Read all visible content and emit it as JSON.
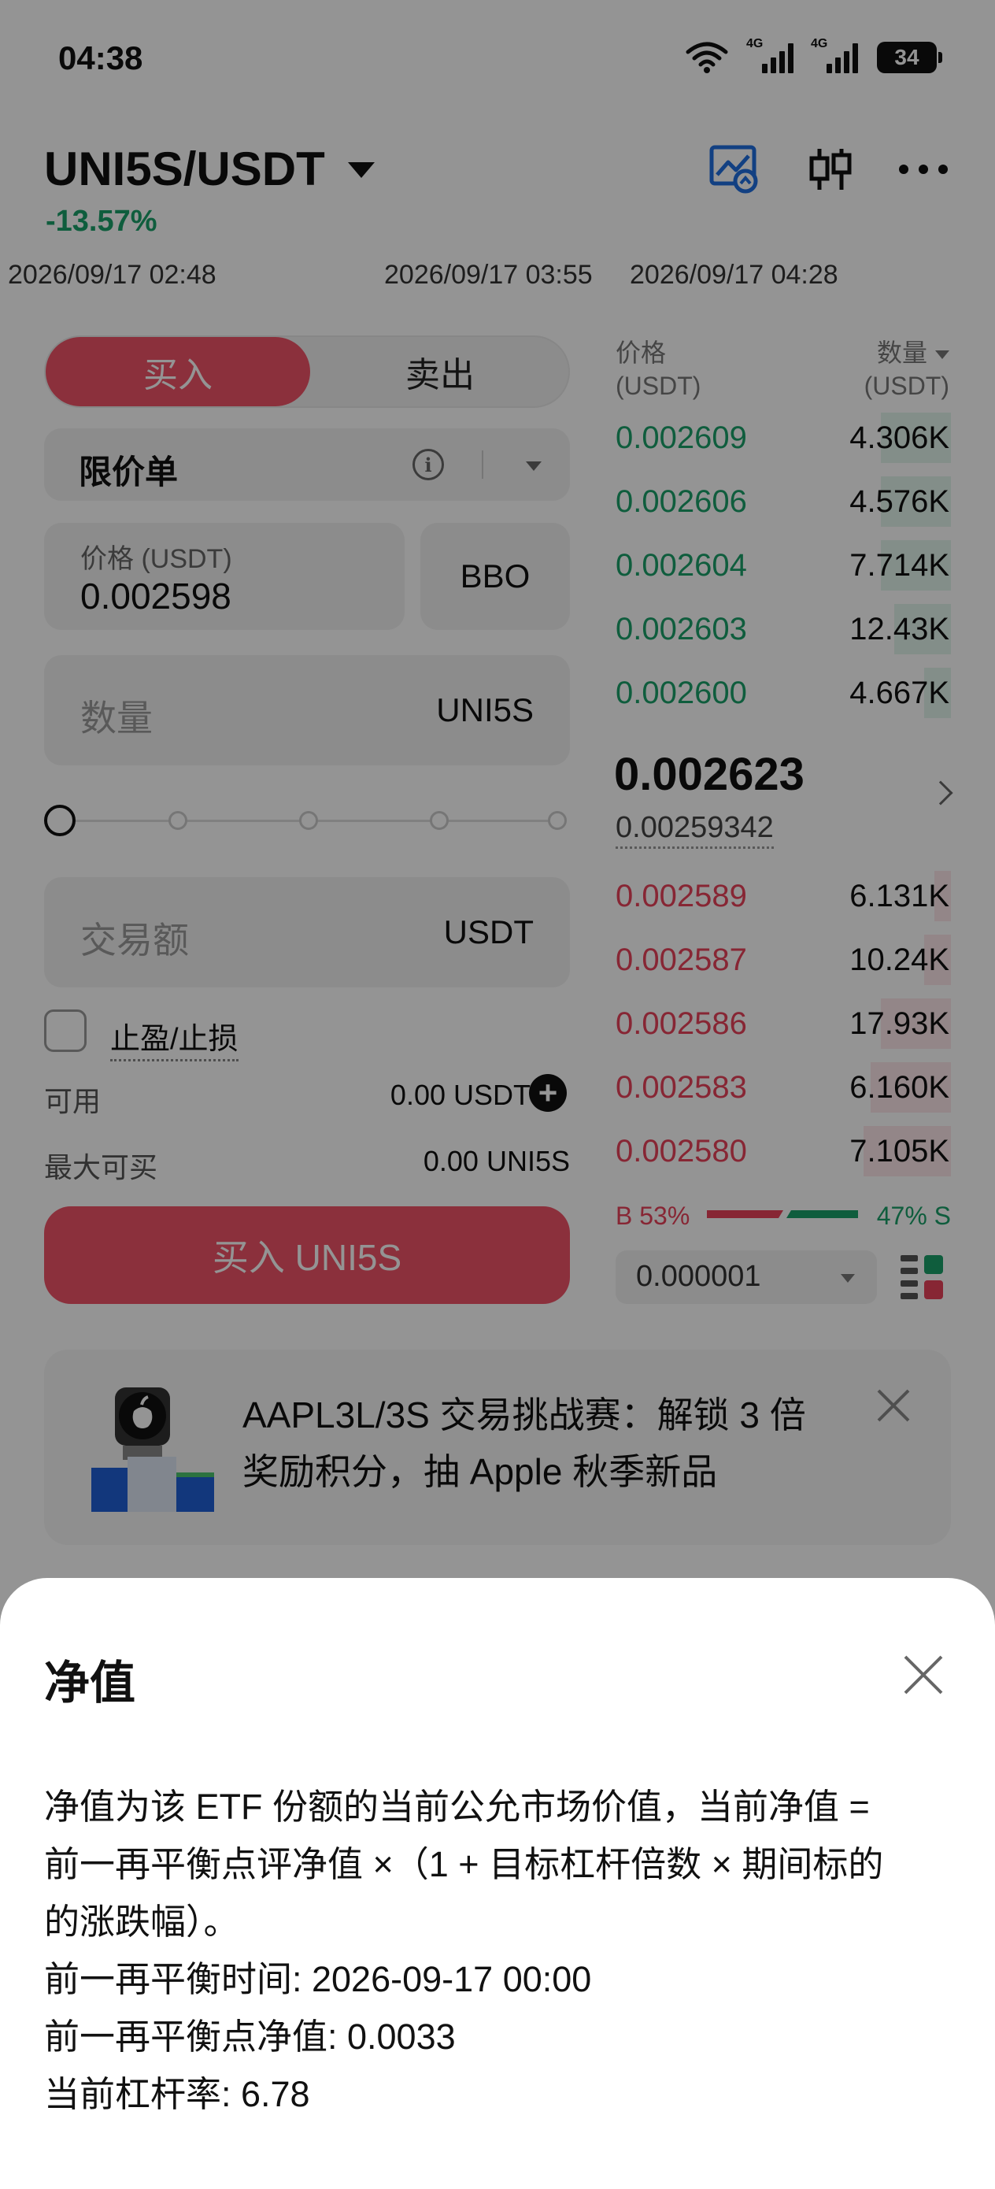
{
  "status_bar": {
    "time": "04:38",
    "network_label_1": "4G",
    "network_label_2": "4G",
    "battery": "34"
  },
  "header": {
    "pair": "UNI5S/USDT",
    "change": "-13.57%",
    "icons": [
      "chart-image-icon",
      "candlestick-icon",
      "more-icon"
    ]
  },
  "ticker_times": [
    "2026/09/17 02:48",
    "2026/09/17 03:55",
    "2026/09/17 04:28"
  ],
  "order_form": {
    "buy_tab": "买入",
    "sell_tab": "卖出",
    "order_type": "限价单",
    "price_label": "价格 (USDT)",
    "price_value": "0.002598",
    "bbo_label": "BBO",
    "qty_placeholder": "数量",
    "qty_unit": "UNI5S",
    "amount_placeholder": "交易额",
    "amount_unit": "USDT",
    "tpsl_label": "止盈/止损",
    "available_label": "可用",
    "available_value": "0.00 USDT",
    "max_buy_label": "最大可买",
    "max_buy_value": "0.00 UNI5S",
    "buy_button": "买入 UNI5S"
  },
  "orderbook": {
    "price_header_1": "价格",
    "price_header_2": "(USDT)",
    "qty_header_1": "数量",
    "qty_header_2": "(USDT)",
    "asks": [
      {
        "price": "0.002609",
        "qty": "4.306K",
        "depth": 0.21
      },
      {
        "price": "0.002606",
        "qty": "4.576K",
        "depth": 0.21
      },
      {
        "price": "0.002604",
        "qty": "7.714K",
        "depth": 0.21
      },
      {
        "price": "0.002603",
        "qty": "12.43K",
        "depth": 0.17
      },
      {
        "price": "0.002600",
        "qty": "4.667K",
        "depth": 0.08
      }
    ],
    "last_price": "0.002623",
    "nav_price": "0.00259342",
    "bids": [
      {
        "price": "0.002589",
        "qty": "6.131K",
        "depth": 0.05
      },
      {
        "price": "0.002587",
        "qty": "10.24K",
        "depth": 0.08
      },
      {
        "price": "0.002586",
        "qty": "17.93K",
        "depth": 0.21
      },
      {
        "price": "0.002583",
        "qty": "6.160K",
        "depth": 0.24
      },
      {
        "price": "0.002580",
        "qty": "7.105K",
        "depth": 0.26
      }
    ],
    "buy_ratio_label": "B 53%",
    "sell_ratio_label": "47% S",
    "buy_ratio": 0.53,
    "sell_ratio": 0.47,
    "tick_size": "0.000001"
  },
  "banner": {
    "line1": "AAPL3L/3S 交易挑战赛：解锁 3 倍",
    "line2": "奖励积分，抽 Apple 秋季新品"
  },
  "sheet": {
    "title": "净值",
    "lines": [
      "净值为该 ETF 份额的当前公允市场价值，当前净值 =",
      "前一再平衡点评净值 ×（1 + 目标杠杆倍数 × 期间标的",
      "的涨跌幅）。",
      "前一再平衡时间: 2026-09-17 00:00",
      "前一再平衡点净值: 0.0033",
      "当前杠杆率: 6.78"
    ]
  },
  "colors": {
    "buy": "#f05468",
    "up": "#1aa06a",
    "down": "#e8425a"
  }
}
